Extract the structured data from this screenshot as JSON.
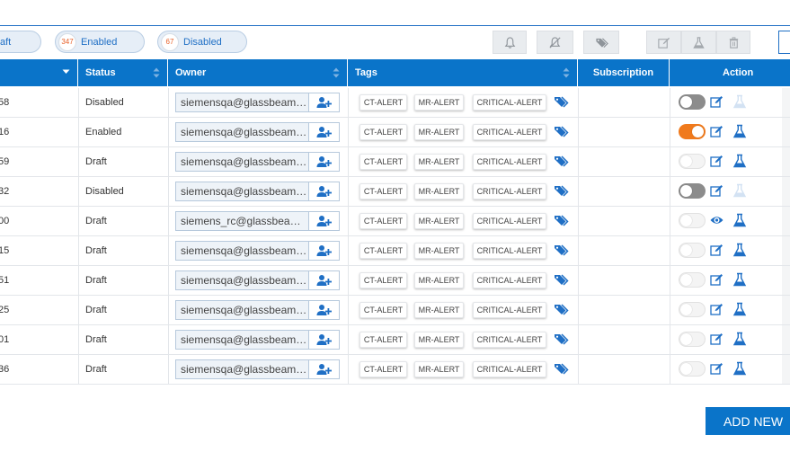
{
  "filters": [
    {
      "label": "aft",
      "count": ""
    },
    {
      "label": "Enabled",
      "count": "347"
    },
    {
      "label": "Disabled",
      "count": "67"
    }
  ],
  "toolbar": {
    "icons": [
      "bell-icon",
      "bell-off-icon",
      "tags-icon",
      "edit-icon",
      "flask-icon",
      "trash-icon"
    ]
  },
  "columns": {
    "id": "",
    "status": "Status",
    "owner": "Owner",
    "tags": "Tags",
    "subscription": "Subscription",
    "action": "Action"
  },
  "colors": {
    "header": "#0a74c9",
    "accent": "#1f6fc5",
    "toggle_on": "#f07a1c",
    "badge_count": "#e8622a"
  },
  "rows": [
    {
      "id": "58",
      "status": "Disabled",
      "owner": "siemensqa@glassbeam.com",
      "tags": [
        "CT-ALERT",
        "MR-ALERT",
        "CRITICAL-ALERT"
      ],
      "subscription": "",
      "toggle": "off-dark",
      "view_icon": "edit-icon",
      "flask": "disabled"
    },
    {
      "id": "16",
      "status": "Enabled",
      "owner": "siemensqa@glassbeam.com",
      "tags": [
        "CT-ALERT",
        "MR-ALERT",
        "CRITICAL-ALERT"
      ],
      "subscription": "",
      "toggle": "on",
      "view_icon": "edit-icon",
      "flask": "active"
    },
    {
      "id": "59",
      "status": "Draft",
      "owner": "siemensqa@glassbeam.com",
      "tags": [
        "CT-ALERT",
        "MR-ALERT",
        "CRITICAL-ALERT"
      ],
      "subscription": "",
      "toggle": "off",
      "view_icon": "edit-icon",
      "flask": "active"
    },
    {
      "id": "32",
      "status": "Disabled",
      "owner": "siemensqa@glassbeam.com",
      "tags": [
        "CT-ALERT",
        "MR-ALERT",
        "CRITICAL-ALERT"
      ],
      "subscription": "",
      "toggle": "off-dark",
      "view_icon": "edit-icon",
      "flask": "disabled"
    },
    {
      "id": "00",
      "status": "Draft",
      "owner": "siemens_rc@glassbeam.com",
      "tags": [
        "CT-ALERT",
        "MR-ALERT",
        "CRITICAL-ALERT"
      ],
      "subscription": "",
      "toggle": "off",
      "view_icon": "eye-icon",
      "flask": "active"
    },
    {
      "id": "15",
      "status": "Draft",
      "owner": "siemensqa@glassbeam.com",
      "tags": [
        "CT-ALERT",
        "MR-ALERT",
        "CRITICAL-ALERT"
      ],
      "subscription": "",
      "toggle": "off",
      "view_icon": "edit-icon",
      "flask": "active"
    },
    {
      "id": "51",
      "status": "Draft",
      "owner": "siemensqa@glassbeam.com",
      "tags": [
        "CT-ALERT",
        "MR-ALERT",
        "CRITICAL-ALERT"
      ],
      "subscription": "",
      "toggle": "off",
      "view_icon": "edit-icon",
      "flask": "active"
    },
    {
      "id": "25",
      "status": "Draft",
      "owner": "siemensqa@glassbeam.com",
      "tags": [
        "CT-ALERT",
        "MR-ALERT",
        "CRITICAL-ALERT"
      ],
      "subscription": "",
      "toggle": "off",
      "view_icon": "edit-icon",
      "flask": "active"
    },
    {
      "id": "01",
      "status": "Draft",
      "owner": "siemensqa@glassbeam.com",
      "tags": [
        "CT-ALERT",
        "MR-ALERT",
        "CRITICAL-ALERT"
      ],
      "subscription": "",
      "toggle": "off",
      "view_icon": "edit-icon",
      "flask": "active"
    },
    {
      "id": "36",
      "status": "Draft",
      "owner": "siemensqa@glassbeam.com",
      "tags": [
        "CT-ALERT",
        "MR-ALERT",
        "CRITICAL-ALERT"
      ],
      "subscription": "",
      "toggle": "off",
      "view_icon": "edit-icon",
      "flask": "active"
    }
  ],
  "add_new_label": "ADD NEW"
}
